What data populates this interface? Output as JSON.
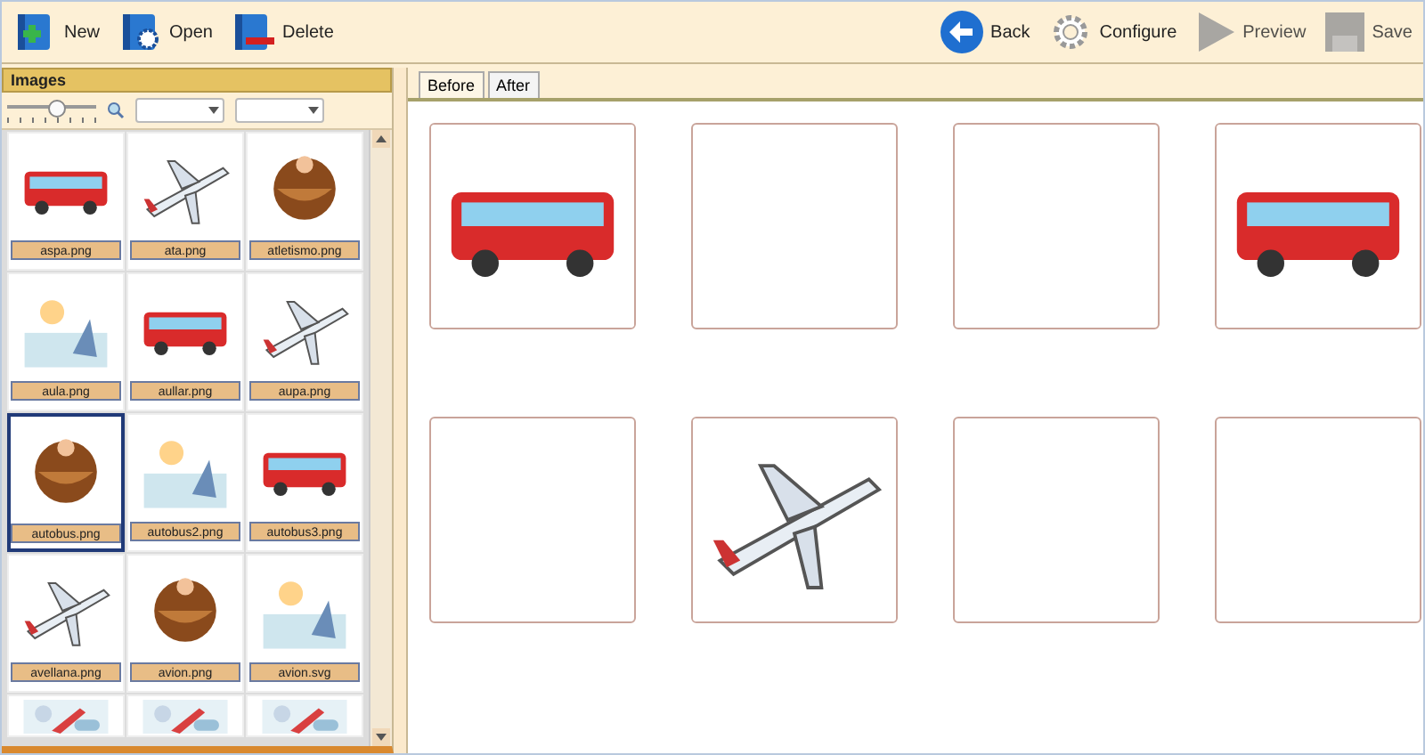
{
  "toolbar": {
    "left": [
      {
        "label": "New",
        "kind": "new",
        "disabled": false
      },
      {
        "label": "Open",
        "kind": "open",
        "disabled": false
      },
      {
        "label": "Delete",
        "kind": "delete",
        "disabled": false
      }
    ],
    "right": [
      {
        "label": "Back",
        "kind": "back",
        "disabled": false
      },
      {
        "label": "Configure",
        "kind": "configure",
        "disabled": false
      },
      {
        "label": "Preview",
        "kind": "preview",
        "disabled": true
      },
      {
        "label": "Save",
        "kind": "save",
        "disabled": true
      }
    ]
  },
  "images_panel": {
    "title": "Images",
    "zoom_slider": {
      "level": 0.55
    },
    "thumbnails": [
      {
        "label": "aspa.png",
        "selected": false
      },
      {
        "label": "ata.png",
        "selected": false
      },
      {
        "label": "atletismo.png",
        "selected": false
      },
      {
        "label": "aula.png",
        "selected": false
      },
      {
        "label": "aullar.png",
        "selected": false
      },
      {
        "label": "aupa.png",
        "selected": false
      },
      {
        "label": "autobus.png",
        "selected": true
      },
      {
        "label": "autobus2.png",
        "selected": false
      },
      {
        "label": "autobus3.png",
        "selected": false
      },
      {
        "label": "avellana.png",
        "selected": false
      },
      {
        "label": "avion.png",
        "selected": false
      },
      {
        "label": "avion.svg",
        "selected": false
      },
      {
        "kind": "picture",
        "selected": false
      },
      {
        "kind": "picture",
        "selected": false
      },
      {
        "kind": "picture",
        "selected": false
      }
    ]
  },
  "tabs": [
    {
      "label": "Before",
      "selected": true
    },
    {
      "label": "After",
      "selected": false
    }
  ],
  "cards": [
    {
      "kind": "picture"
    },
    {
      "kind": "empty"
    },
    {
      "kind": "empty"
    },
    {
      "kind": "picture"
    },
    {
      "kind": "empty"
    },
    {
      "kind": "picture"
    },
    {
      "kind": "empty"
    },
    {
      "kind": "empty"
    }
  ]
}
